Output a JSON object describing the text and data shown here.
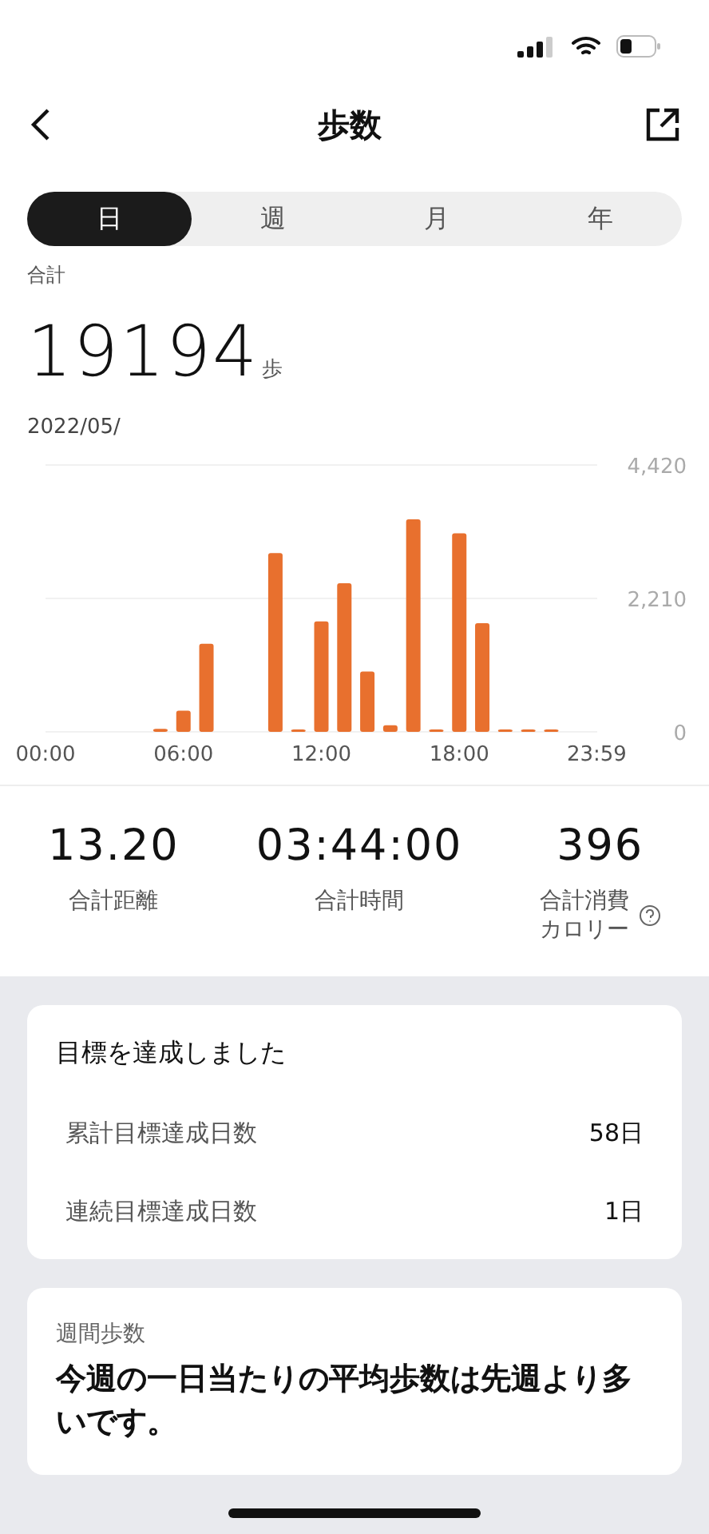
{
  "header": {
    "title": "歩数"
  },
  "tabs": [
    {
      "label": "日",
      "selected": true
    },
    {
      "label": "週",
      "selected": false
    },
    {
      "label": "月",
      "selected": false
    },
    {
      "label": "年",
      "selected": false
    }
  ],
  "summary": {
    "label": "合計",
    "value": "19194",
    "unit": "歩",
    "date": "2022/05/"
  },
  "chart_data": {
    "type": "bar",
    "x": [
      0,
      1,
      2,
      3,
      4,
      5,
      6,
      7,
      8,
      9,
      10,
      11,
      12,
      13,
      14,
      15,
      16,
      17,
      18,
      19,
      20,
      21,
      22,
      23
    ],
    "values": [
      0,
      0,
      0,
      0,
      0,
      50,
      350,
      1460,
      0,
      0,
      2960,
      20,
      1830,
      2460,
      1000,
      110,
      3520,
      20,
      3290,
      1800,
      10,
      20,
      10,
      0
    ],
    "xlim": [
      0,
      24
    ],
    "ylim": [
      0,
      4420
    ],
    "yticks": [
      {
        "value": 0,
        "label": "0"
      },
      {
        "value": 2210,
        "label": "2,210"
      },
      {
        "value": 4420,
        "label": "4,420"
      }
    ],
    "xticks": [
      {
        "value": 0,
        "label": "00:00"
      },
      {
        "value": 6,
        "label": "06:00"
      },
      {
        "value": 12,
        "label": "12:00"
      },
      {
        "value": 18,
        "label": "18:00"
      },
      {
        "value": 23.98,
        "label": "23:59"
      }
    ]
  },
  "stats": [
    {
      "value": "13.20",
      "label": "合計距離",
      "help": false
    },
    {
      "value": "03:44:00",
      "label": "合計時間",
      "help": false
    },
    {
      "value": "396",
      "label": "合計消費カロリー",
      "help": true
    }
  ],
  "goal_card": {
    "title": "目標を達成しました",
    "rows": [
      {
        "label": "累計目標達成日数",
        "value": "58日"
      },
      {
        "label": "連続目標達成日数",
        "value": "1日"
      }
    ]
  },
  "weekly_card": {
    "label": "週間歩数",
    "message": "今週の一日当たりの平均歩数は先週より多いです。"
  }
}
